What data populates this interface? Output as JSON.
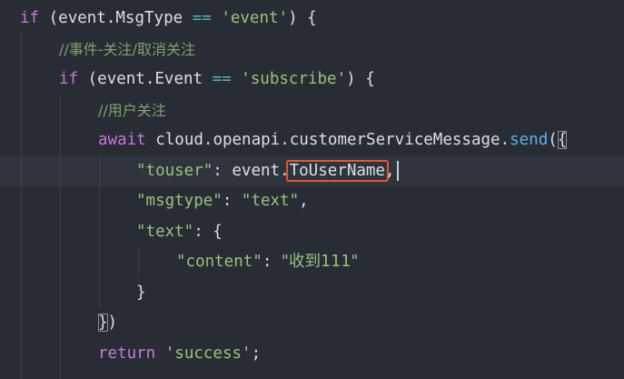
{
  "editor": {
    "lines": [
      {
        "id": "l1",
        "tokens": [
          {
            "t": "if",
            "c": "kw"
          },
          {
            "t": " (",
            "c": "punc"
          },
          {
            "t": "event",
            "c": "var"
          },
          {
            "t": ".",
            "c": "punc"
          },
          {
            "t": "MsgType",
            "c": "prop"
          },
          {
            "t": " == ",
            "c": "op"
          },
          {
            "t": "'event'",
            "c": "str"
          },
          {
            "t": ") {",
            "c": "punc"
          }
        ]
      },
      {
        "id": "l2",
        "tokens": [
          {
            "t": "//事件-关注/取消关注",
            "c": "cmt"
          }
        ]
      },
      {
        "id": "l3",
        "tokens": [
          {
            "t": "if",
            "c": "kw"
          },
          {
            "t": " (",
            "c": "punc"
          },
          {
            "t": "event",
            "c": "var"
          },
          {
            "t": ".",
            "c": "punc"
          },
          {
            "t": "Event",
            "c": "prop"
          },
          {
            "t": " == ",
            "c": "op"
          },
          {
            "t": "'subscribe'",
            "c": "str"
          },
          {
            "t": ") {",
            "c": "punc"
          }
        ]
      },
      {
        "id": "l4",
        "tokens": [
          {
            "t": "//用户关注",
            "c": "cmt"
          }
        ]
      },
      {
        "id": "l5",
        "tokens": [
          {
            "t": "await",
            "c": "kw"
          },
          {
            "t": " cloud",
            "c": "var"
          },
          {
            "t": ".",
            "c": "punc"
          },
          {
            "t": "openapi",
            "c": "prop"
          },
          {
            "t": ".",
            "c": "punc"
          },
          {
            "t": "customerServiceMessage",
            "c": "prop"
          },
          {
            "t": ".",
            "c": "punc"
          },
          {
            "t": "send",
            "c": "fn"
          },
          {
            "t": "(",
            "c": "punc"
          },
          {
            "t": "{",
            "c": "punc bracket-match"
          }
        ]
      },
      {
        "id": "l6",
        "tokens": [
          {
            "t": "\"touser\"",
            "c": "key"
          },
          {
            "t": ": ",
            "c": "punc"
          },
          {
            "t": "event",
            "c": "var"
          },
          {
            "t": ".",
            "c": "punc"
          },
          {
            "t": "ToUserName",
            "c": "prop highlight-box"
          },
          {
            "t": ",",
            "c": "punc"
          }
        ]
      },
      {
        "id": "l7",
        "tokens": [
          {
            "t": "\"msgtype\"",
            "c": "key"
          },
          {
            "t": ": ",
            "c": "punc"
          },
          {
            "t": "\"text\"",
            "c": "str"
          },
          {
            "t": ",",
            "c": "punc"
          }
        ]
      },
      {
        "id": "l8",
        "tokens": [
          {
            "t": "\"text\"",
            "c": "key"
          },
          {
            "t": ": {",
            "c": "punc"
          }
        ]
      },
      {
        "id": "l9",
        "tokens": [
          {
            "t": "\"content\"",
            "c": "key"
          },
          {
            "t": ": ",
            "c": "punc"
          },
          {
            "t": "\"收到111\"",
            "c": "str cn"
          }
        ]
      },
      {
        "id": "l10",
        "tokens": [
          {
            "t": "}",
            "c": "punc"
          }
        ]
      },
      {
        "id": "l11",
        "tokens": [
          {
            "t": "}",
            "c": "punc bracket-match"
          },
          {
            "t": ")",
            "c": "punc"
          }
        ]
      },
      {
        "id": "l12",
        "tokens": [
          {
            "t": "return",
            "c": "kw"
          },
          {
            "t": " 'success'",
            "c": "str"
          },
          {
            "t": ";",
            "c": "punc"
          }
        ]
      }
    ]
  }
}
